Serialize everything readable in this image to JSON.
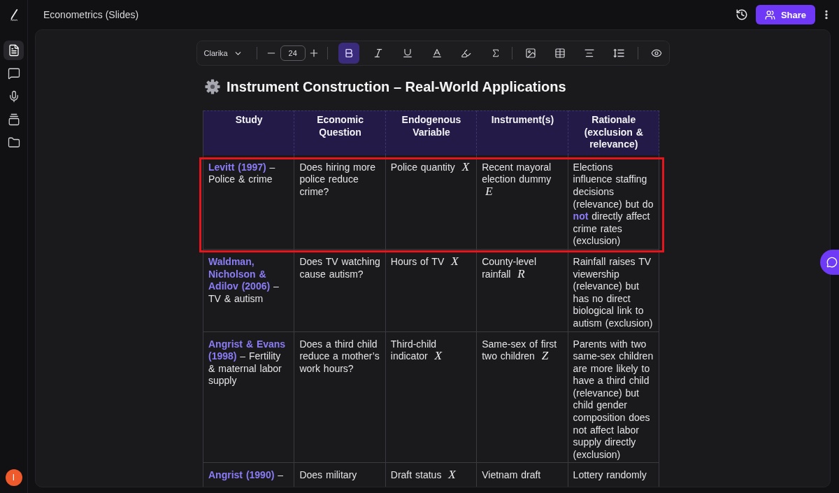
{
  "header": {
    "document_title": "Econometrics (Slides)",
    "share_label": "Share"
  },
  "sidebar": {
    "items": [
      {
        "kind": "document",
        "selected": true
      },
      {
        "kind": "comments",
        "selected": false
      },
      {
        "kind": "microphone",
        "selected": false
      },
      {
        "kind": "stack",
        "selected": false
      },
      {
        "kind": "folder",
        "selected": false
      }
    ],
    "user_initial": "I"
  },
  "toolbar": {
    "font": "Clarika",
    "font_size": "24",
    "format_buttons": [
      {
        "kind": "bold",
        "active": true
      },
      {
        "kind": "italic",
        "active": false
      },
      {
        "kind": "underline",
        "active": false
      }
    ]
  },
  "slide": {
    "title": "Instrument Construction – Real-World Applications",
    "table": {
      "columns": [
        "Study",
        "Economic Question",
        "Endogenous Variable",
        "Instrument(s)",
        "Rationale (exclusion & relevance)"
      ],
      "rows": [
        {
          "highlighted": true,
          "cells": [
            "**Levitt (1997)** – Police & crime",
            "Does hiring more police reduce crime?",
            "Police quantity *X*",
            "Recent mayoral election dummy *E*",
            "Elections influence staffing decisions (relevance) but do **not** directly affect crime rates (exclusion)"
          ]
        },
        {
          "highlighted": false,
          "cells": [
            "**Waldman, Nicholson & Adilov (2006)** – TV & autism",
            "Does TV watching cause autism?",
            "Hours of TV *X*",
            "County-level rainfall *R*",
            "Rainfall raises TV viewership (relevance) but has no direct biological link to autism (exclusion)"
          ]
        },
        {
          "highlighted": false,
          "cells": [
            "**Angrist & Evans (1998)** – Fertility & maternal labor supply",
            "Does a third child reduce a mother’s work hours?",
            "Third-child indicator *X*",
            "Same-sex of first two children *Z*",
            "Parents with two same-sex children are more likely to have a third child (relevance) but child gender composition does not affect labor supply directly (exclusion)"
          ]
        },
        {
          "highlighted": false,
          "cells": [
            "**Angrist (1990)** –",
            "Does military",
            "Draft status *X*",
            "Vietnam draft",
            "Lottery randomly"
          ]
        }
      ]
    }
  }
}
